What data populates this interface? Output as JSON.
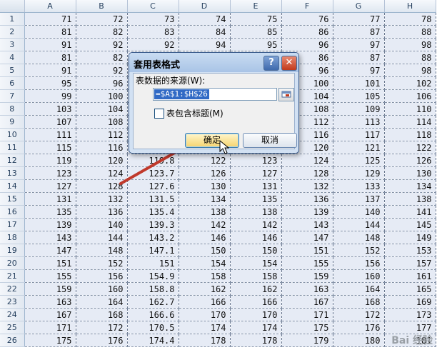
{
  "sheet": {
    "column_headers": [
      "A",
      "B",
      "C",
      "D",
      "E",
      "F",
      "G",
      "H"
    ],
    "rows": [
      {
        "n": "1",
        "cells": [
          "71",
          "72",
          "73",
          "74",
          "75",
          "76",
          "77",
          "78"
        ]
      },
      {
        "n": "2",
        "cells": [
          "81",
          "82",
          "83",
          "84",
          "85",
          "86",
          "87",
          "88"
        ]
      },
      {
        "n": "3",
        "cells": [
          "91",
          "92",
          "92",
          "94",
          "95",
          "96",
          "97",
          "98"
        ]
      },
      {
        "n": "4",
        "cells": [
          "81",
          "82",
          "",
          "",
          "",
          "86",
          "87",
          "88"
        ]
      },
      {
        "n": "5",
        "cells": [
          "91",
          "92",
          "",
          "",
          "",
          "96",
          "97",
          "98"
        ]
      },
      {
        "n": "6",
        "cells": [
          "95",
          "96",
          "",
          "",
          "",
          "100",
          "101",
          "102"
        ]
      },
      {
        "n": "7",
        "cells": [
          "99",
          "100",
          "",
          "",
          "",
          "104",
          "105",
          "106"
        ]
      },
      {
        "n": "8",
        "cells": [
          "103",
          "104",
          "",
          "",
          "",
          "108",
          "109",
          "110"
        ]
      },
      {
        "n": "9",
        "cells": [
          "107",
          "108",
          "",
          "",
          "",
          "112",
          "113",
          "114"
        ]
      },
      {
        "n": "10",
        "cells": [
          "111",
          "112",
          "",
          "",
          "",
          "116",
          "117",
          "118"
        ]
      },
      {
        "n": "11",
        "cells": [
          "115",
          "116",
          "",
          "",
          "",
          "120",
          "121",
          "122"
        ]
      },
      {
        "n": "12",
        "cells": [
          "119",
          "120",
          "119.8",
          "122",
          "123",
          "124",
          "125",
          "126"
        ]
      },
      {
        "n": "13",
        "cells": [
          "123",
          "124",
          "123.7",
          "126",
          "127",
          "128",
          "129",
          "130"
        ]
      },
      {
        "n": "14",
        "cells": [
          "127",
          "128",
          "127.6",
          "130",
          "131",
          "132",
          "133",
          "134"
        ]
      },
      {
        "n": "15",
        "cells": [
          "131",
          "132",
          "131.5",
          "134",
          "135",
          "136",
          "137",
          "138"
        ]
      },
      {
        "n": "16",
        "cells": [
          "135",
          "136",
          "135.4",
          "138",
          "138",
          "139",
          "140",
          "141"
        ]
      },
      {
        "n": "17",
        "cells": [
          "139",
          "140",
          "139.3",
          "142",
          "142",
          "143",
          "144",
          "145"
        ]
      },
      {
        "n": "18",
        "cells": [
          "143",
          "144",
          "143.2",
          "146",
          "146",
          "147",
          "148",
          "149"
        ]
      },
      {
        "n": "19",
        "cells": [
          "147",
          "148",
          "147.1",
          "150",
          "150",
          "151",
          "152",
          "153"
        ]
      },
      {
        "n": "20",
        "cells": [
          "151",
          "152",
          "151",
          "154",
          "154",
          "155",
          "156",
          "157"
        ]
      },
      {
        "n": "21",
        "cells": [
          "155",
          "156",
          "154.9",
          "158",
          "158",
          "159",
          "160",
          "161"
        ]
      },
      {
        "n": "22",
        "cells": [
          "159",
          "160",
          "158.8",
          "162",
          "162",
          "163",
          "164",
          "165"
        ]
      },
      {
        "n": "23",
        "cells": [
          "163",
          "164",
          "162.7",
          "166",
          "166",
          "167",
          "168",
          "169"
        ]
      },
      {
        "n": "24",
        "cells": [
          "167",
          "168",
          "166.6",
          "170",
          "170",
          "171",
          "172",
          "173"
        ]
      },
      {
        "n": "25",
        "cells": [
          "171",
          "172",
          "170.5",
          "174",
          "174",
          "175",
          "176",
          "177"
        ]
      },
      {
        "n": "26",
        "cells": [
          "175",
          "176",
          "174.4",
          "178",
          "178",
          "179",
          "180",
          "181"
        ]
      }
    ]
  },
  "dialog": {
    "title": "套用表格式",
    "help_label": "?",
    "close_label": "✕",
    "source_label": "表数据的来源(W):",
    "range_value": "=$A$1:$H$26",
    "has_headers_label": "表包含标题(M)",
    "has_headers_checked": false,
    "ok_label": "确定",
    "cancel_label": "取消"
  },
  "colors": {
    "arrow": "#c0392b",
    "cell_fill": "#e6ebf5",
    "selection": "#316ac5"
  },
  "icons": {
    "collapse": "range-collapse-icon",
    "cursor": "mouse-pointer-icon",
    "arrow": "annotation-arrow-icon"
  },
  "watermark": "Bai 经验"
}
